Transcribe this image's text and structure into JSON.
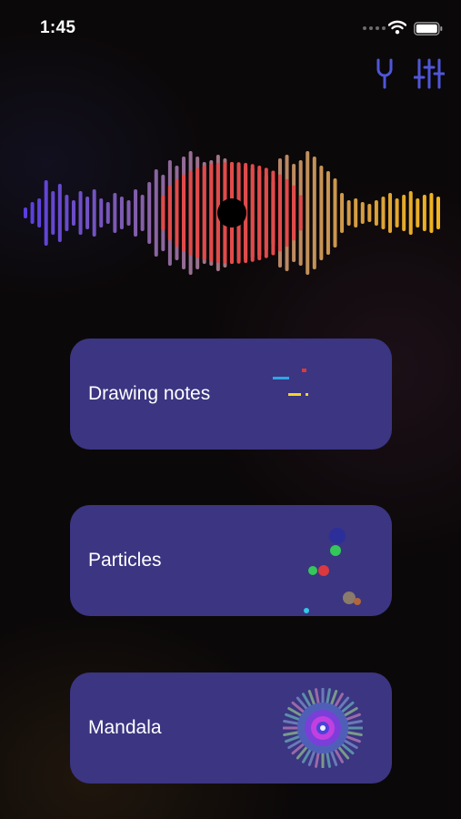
{
  "status_bar": {
    "time": "1:45"
  },
  "toolbar": {
    "tuner_icon": "tuning-fork-icon",
    "settings_icon": "sliders-icon",
    "accent_color": "#4f56d8"
  },
  "visualizer": {
    "left_color": "#5a3fe0",
    "center_color": "#e24a4a",
    "right_color": "#f2b41c"
  },
  "menu": {
    "items": [
      {
        "label": "Drawing notes"
      },
      {
        "label": "Particles"
      },
      {
        "label": "Mandala"
      }
    ]
  },
  "colors": {
    "card_background": "#3b3582",
    "page_background": "#0b0809"
  }
}
